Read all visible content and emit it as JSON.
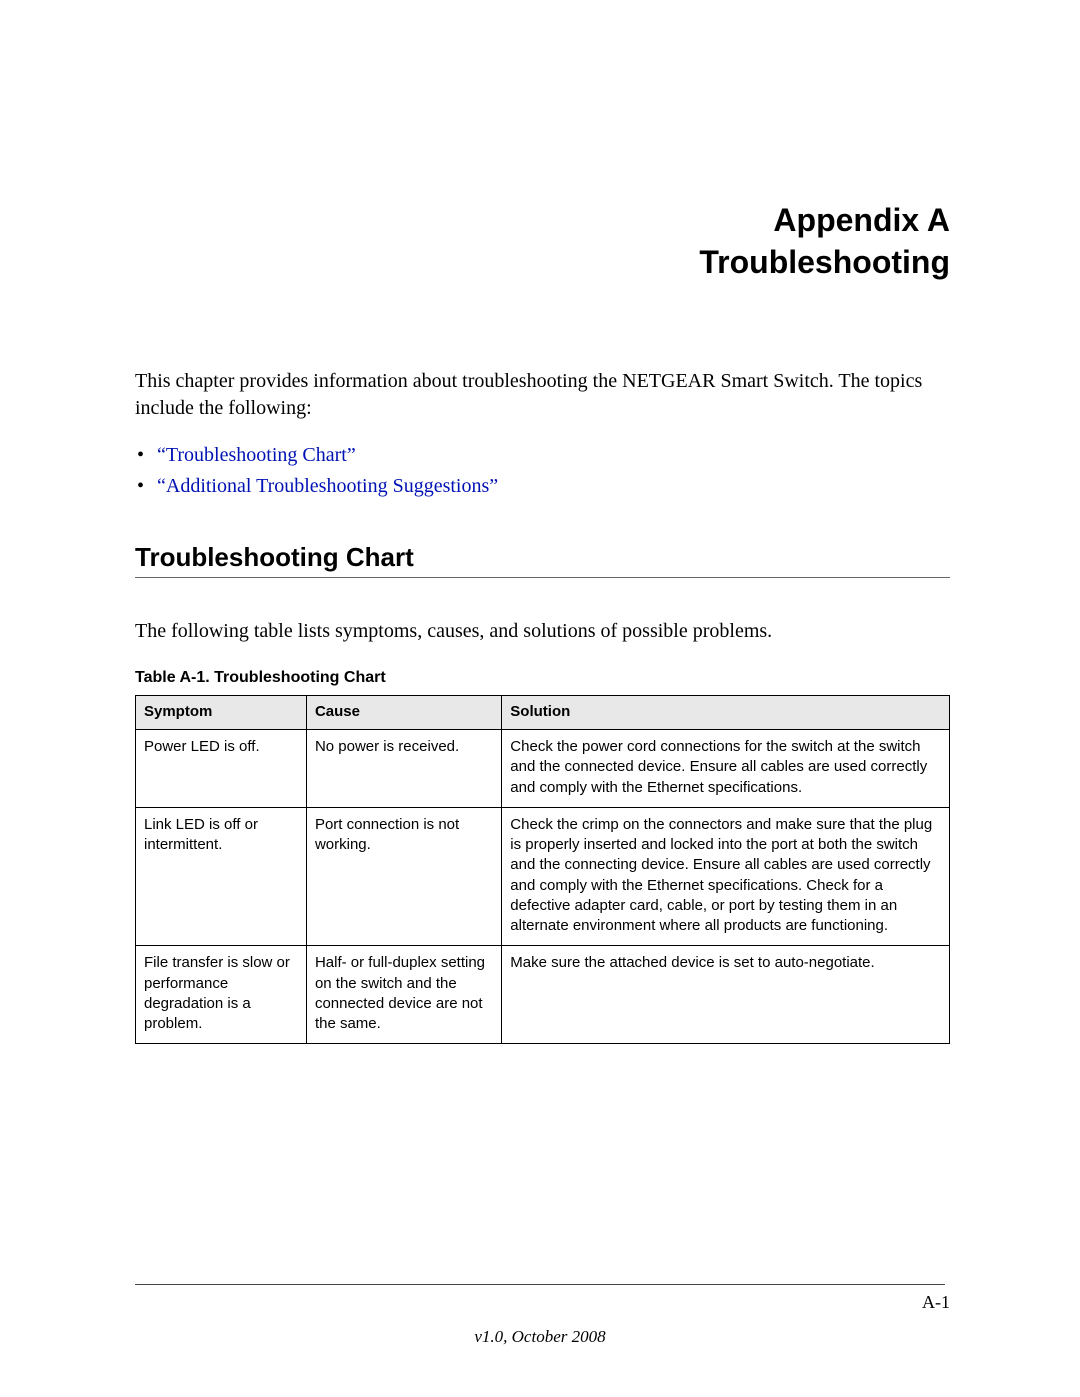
{
  "title_line1": "Appendix A",
  "title_line2": "Troubleshooting",
  "intro": "This chapter provides information about troubleshooting the NETGEAR Smart Switch. The topics include the following:",
  "toc": {
    "item1": "“Troubleshooting Chart”",
    "item2": "“Additional Troubleshooting Suggestions”"
  },
  "section_heading": "Troubleshooting Chart",
  "section_intro": "The following table lists symptoms, causes, and solutions of possible problems.",
  "table_caption": "Table A-1. Troubleshooting Chart",
  "table_headers": {
    "symptom": "Symptom",
    "cause": "Cause",
    "solution": "Solution"
  },
  "rows": [
    {
      "symptom": "Power LED is off.",
      "cause": "No power is received.",
      "solution": "Check the power cord connections for the switch at the switch and the connected device. Ensure all cables are used correctly and comply with the Ethernet specifications."
    },
    {
      "symptom": "Link LED is off or intermittent.",
      "cause": "Port connection is not working.",
      "solution": "Check the crimp on the connectors and make sure that the plug is properly inserted and locked into the port at both the switch and the connecting device. Ensure all cables are used correctly and comply with the Ethernet specifications. Check for a defective adapter card, cable, or port by testing them in an alternate environment where all products are functioning."
    },
    {
      "symptom": "File transfer is slow or performance degradation is a problem.",
      "cause": "Half- or full-duplex setting on the switch and the connected device are not the same.",
      "solution": "Make sure the attached device is set to auto-negotiate."
    }
  ],
  "page_number": "A-1",
  "version": "v1.0, October 2008"
}
